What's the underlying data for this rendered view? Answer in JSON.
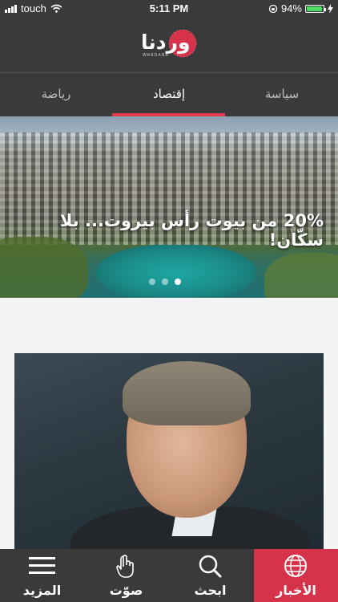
{
  "status": {
    "carrier": "touch",
    "time": "5:11 PM",
    "battery": "94%",
    "battery_level": 0.94
  },
  "header": {
    "logo_text": "وردنا",
    "logo_sub": "WARDANA"
  },
  "tabs": [
    {
      "label": "سياسة"
    },
    {
      "label": "إقتصاد"
    },
    {
      "label": "رياضة"
    }
  ],
  "hero": {
    "title": "20% من بيوت رأس بيروت... بلا سكّان!"
  },
  "nav": [
    {
      "label": "المزيد",
      "icon": "menu-icon"
    },
    {
      "label": "صوّت",
      "icon": "hand-pointer-icon"
    },
    {
      "label": "ابحث",
      "icon": "search-icon"
    },
    {
      "label": "الأخبار",
      "icon": "globe-icon"
    }
  ],
  "colors": {
    "accent": "#d6324a",
    "bar": "#3a3a3a"
  }
}
